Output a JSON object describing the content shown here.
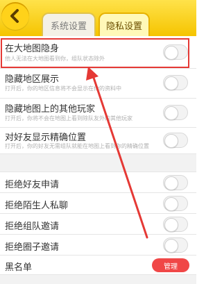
{
  "tabs": [
    {
      "label": "系统设置"
    },
    {
      "label": "隐私设置"
    }
  ],
  "settings": [
    {
      "title": "在大地图隐身",
      "desc": "他人无法在大地图看到你，组队状态除外"
    },
    {
      "title": "隐藏地区展示",
      "desc": "打开后，你的地区信息将不会显示在你的资料中"
    },
    {
      "title": "隐藏地图上的其他玩家",
      "desc": "打开后，你将不会在地图上看到除队友外的其他玩家"
    },
    {
      "title": "对好友显示精确位置",
      "desc": "打开后，你的好友无需组队就能在地图上看到你的精确位置"
    }
  ],
  "privacy": [
    {
      "title": "拒绝好友申请"
    },
    {
      "title": "拒绝陌生人私聊"
    },
    {
      "title": "拒绝组队邀请"
    },
    {
      "title": "拒绝圈子邀请"
    }
  ],
  "blacklist": {
    "title": "黑名单",
    "button": "管理"
  },
  "colors": {
    "header": "#f5c400",
    "accent_red": "#e53935",
    "manage_button": "#f04747"
  },
  "icons": {
    "back": "back-arrow-icon"
  }
}
